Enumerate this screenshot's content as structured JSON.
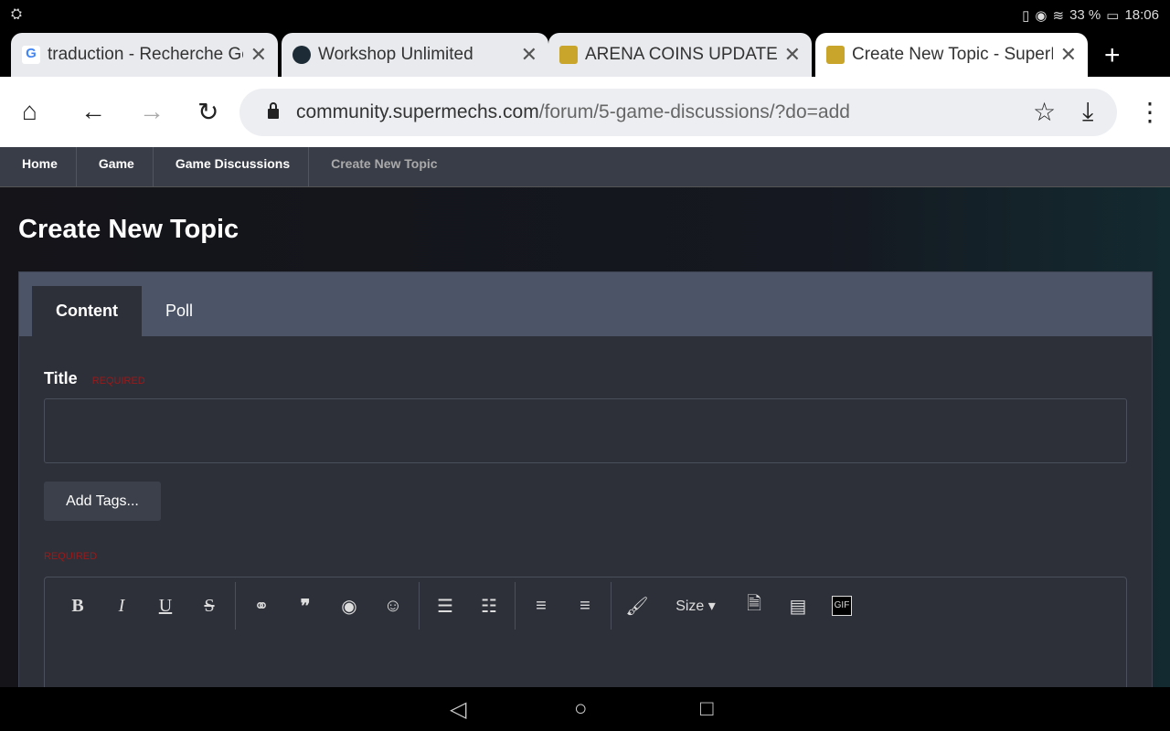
{
  "status": {
    "battery": "33 %",
    "time": "18:06"
  },
  "tabs": [
    {
      "title": "traduction - Recherche Goo",
      "favicon": "google-icon"
    },
    {
      "title": "Workshop Unlimited",
      "favicon": "workshop-icon"
    },
    {
      "title": "ARENA COINS UPDATE - G",
      "favicon": "supermechs-icon"
    },
    {
      "title": "Create New Topic - SuperM",
      "favicon": "supermechs-icon",
      "active": true
    }
  ],
  "url": {
    "domain": "community.supermechs.com",
    "path": "/forum/5-game-discussions/?do=add"
  },
  "breadcrumbs": [
    "Home",
    "Game",
    "Game Discussions",
    "Create New Topic"
  ],
  "page": {
    "title": "Create New Topic"
  },
  "form": {
    "tabs": [
      "Content",
      "Poll"
    ],
    "title_label": "Title",
    "required": "REQUIRED",
    "title_value": "",
    "add_tags": "Add Tags...",
    "toolbar": {
      "bold": "B",
      "italic": "I",
      "underline": "U",
      "strike": "S",
      "size": "Size",
      "gif": "GIF"
    }
  }
}
